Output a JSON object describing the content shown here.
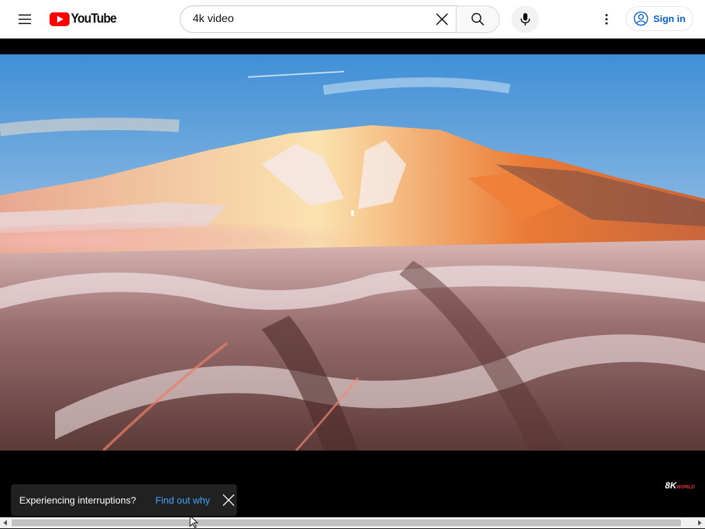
{
  "header": {
    "logo_text": "YouTube",
    "search_value": "4k video",
    "search_placeholder": "Search",
    "sign_in_label": "Sign in"
  },
  "player": {
    "watermark_main": "8K",
    "watermark_sub": "WORLD"
  },
  "toast": {
    "message": "Experiencing interruptions?",
    "link_label": "Find out why"
  },
  "colors": {
    "brand_red": "#ff0000",
    "link_blue": "#065fd4",
    "toast_link": "#3ea6ff",
    "toast_bg": "#212121"
  },
  "icons": [
    "menu-icon",
    "youtube-logo-icon",
    "clear-icon",
    "search-icon",
    "mic-icon",
    "more-vert-icon",
    "account-icon",
    "close-icon",
    "scroll-left-icon",
    "scroll-right-icon",
    "cursor-icon"
  ]
}
